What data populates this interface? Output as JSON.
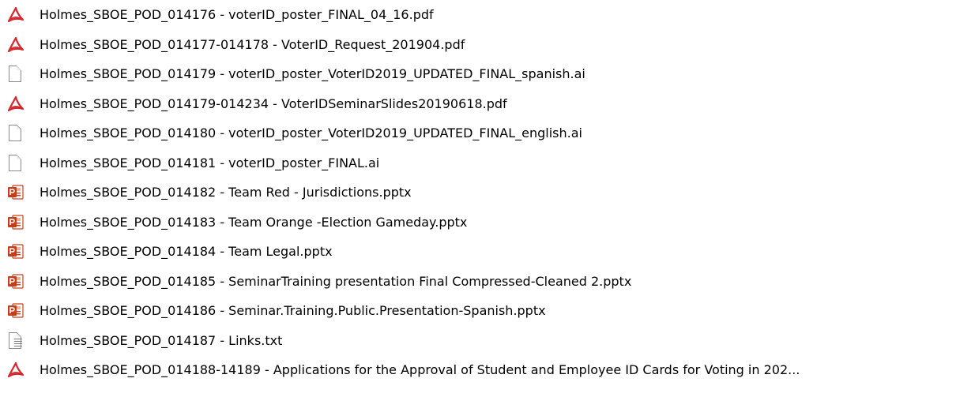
{
  "files": [
    {
      "icon": "pdf",
      "name": "Holmes_SBOE_POD_014176 - voterID_poster_FINAL_04_16.pdf"
    },
    {
      "icon": "pdf",
      "name": "Holmes_SBOE_POD_014177-014178 - VoterID_Request_201904.pdf"
    },
    {
      "icon": "blank",
      "name": "Holmes_SBOE_POD_014179 - voterID_poster_VoterID2019_UPDATED_FINAL_spanish.ai"
    },
    {
      "icon": "pdf",
      "name": "Holmes_SBOE_POD_014179-014234 - VoterIDSeminarSlides20190618.pdf"
    },
    {
      "icon": "blank",
      "name": "Holmes_SBOE_POD_014180 - voterID_poster_VoterID2019_UPDATED_FINAL_english.ai"
    },
    {
      "icon": "blank",
      "name": "Holmes_SBOE_POD_014181 - voterID_poster_FINAL.ai"
    },
    {
      "icon": "ppt",
      "name": "Holmes_SBOE_POD_014182 - Team Red - Jurisdictions.pptx"
    },
    {
      "icon": "ppt",
      "name": "Holmes_SBOE_POD_014183 - Team Orange -Election Gameday.pptx"
    },
    {
      "icon": "ppt",
      "name": "Holmes_SBOE_POD_014184 - Team Legal.pptx"
    },
    {
      "icon": "ppt",
      "name": "Holmes_SBOE_POD_014185 - SeminarTraining presentation Final Compressed-Cleaned 2.pptx"
    },
    {
      "icon": "ppt",
      "name": "Holmes_SBOE_POD_014186 - Seminar.Training.Public.Presentation-Spanish.pptx"
    },
    {
      "icon": "txt",
      "name": "Holmes_SBOE_POD_014187 - Links.txt"
    },
    {
      "icon": "pdf",
      "name": "Holmes_SBOE_POD_014188-14189 - Applications for the Approval of Student and Employee ID Cards for Voting in 202..."
    }
  ]
}
